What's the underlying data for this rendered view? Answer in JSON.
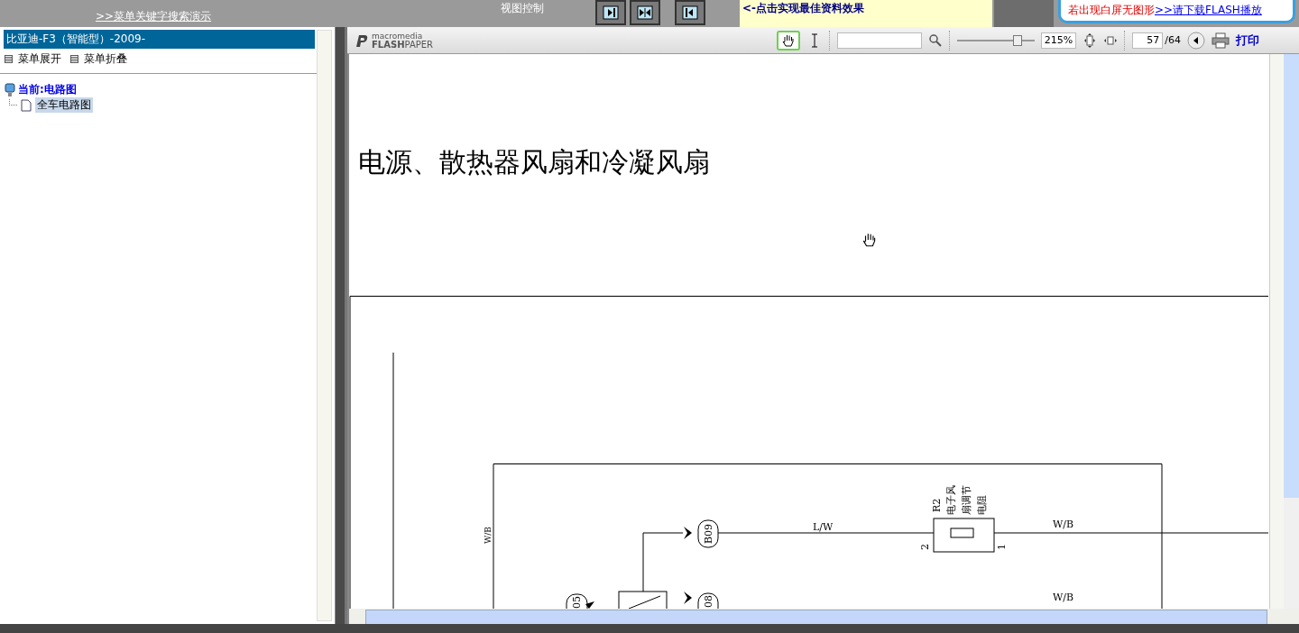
{
  "banner": {
    "search_demo_link": ">>菜单关键字搜索演示",
    "view_control_label": "视图控制",
    "view_buttons": [
      {
        "kind": "right"
      },
      {
        "kind": "both"
      },
      {
        "kind": "left"
      }
    ],
    "hint": "<-点击实现最佳资料效果",
    "notice": {
      "warning": "若出现白屏无图形",
      "link": ">>请下载FLASH播放"
    }
  },
  "sidebar": {
    "title": "比亚迪-F3（智能型）-2009-",
    "actions": [
      "菜单展开",
      "菜单折叠"
    ],
    "tree": [
      {
        "label": "当前:电路图",
        "children": [
          {
            "label": "全车电路图",
            "selected": true
          }
        ]
      }
    ]
  },
  "viewer": {
    "logo": {
      "top": "macromedia",
      "brand_bold": "FLASH",
      "brand": "PAPER"
    },
    "toolbar": {
      "tools": [
        {
          "kind": "hand",
          "selected": true
        },
        {
          "kind": "text",
          "selected": false
        }
      ],
      "zoom": {
        "level": 0.78,
        "reading": "215%"
      },
      "page": "57",
      "page_total": "/64",
      "print": "打印"
    },
    "page_title": "电源、散热器风扇和冷凝风扇",
    "diagram": {
      "labels": [
        "W/B",
        "B09",
        "L/W",
        "R2",
        "电子风",
        "扇调节",
        "电阻",
        "2",
        "1",
        "W/B",
        "W/B",
        "08",
        "05"
      ]
    }
  }
}
